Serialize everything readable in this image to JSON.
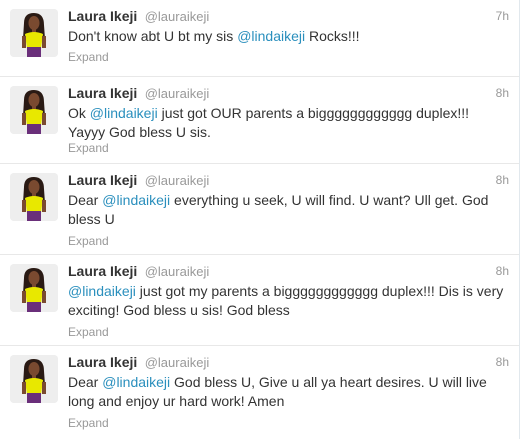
{
  "colors": {
    "link": "#2a8fbd",
    "muted": "#999999",
    "text": "#333333",
    "divider": "#e8e8e8"
  },
  "tweets": [
    {
      "name": "Laura Ikeji",
      "handle": "@lauraikeji",
      "time": "7h",
      "before": "Don't know abt U bt my sis ",
      "mention": "@lindaikeji",
      "after": " Rocks!!!",
      "expand": "Expand",
      "avatar_icon": "profile-photo"
    },
    {
      "name": "Laura Ikeji",
      "handle": "@lauraikeji",
      "time": "8h",
      "before": "Ok ",
      "mention": "@lindaikeji",
      "after": " just got OUR parents a bigggggggggggg duplex!!! Yayyy God bless U sis.",
      "expand": "Expand",
      "avatar_icon": "profile-photo"
    },
    {
      "name": "Laura Ikeji",
      "handle": "@lauraikeji",
      "time": "8h",
      "before": "Dear ",
      "mention": "@lindaikeji",
      "after": " everything u seek, U will find. U want? Ull get. God bless U",
      "expand": "Expand",
      "avatar_icon": "profile-photo"
    },
    {
      "name": "Laura Ikeji",
      "handle": "@lauraikeji",
      "time": "8h",
      "before": "",
      "mention": "@lindaikeji",
      "after": " just got my parents a bigggggggggggg duplex!!! Dis is very exciting! God bless u sis! God bless",
      "expand": "Expand",
      "avatar_icon": "profile-photo"
    },
    {
      "name": "Laura Ikeji",
      "handle": "@lauraikeji",
      "time": "8h",
      "before": "Dear ",
      "mention": "@lindaikeji",
      "after": " God bless U, Give u all ya heart desires. U will live long and enjoy ur hard work! Amen",
      "expand": "Expand",
      "avatar_icon": "profile-photo"
    }
  ]
}
